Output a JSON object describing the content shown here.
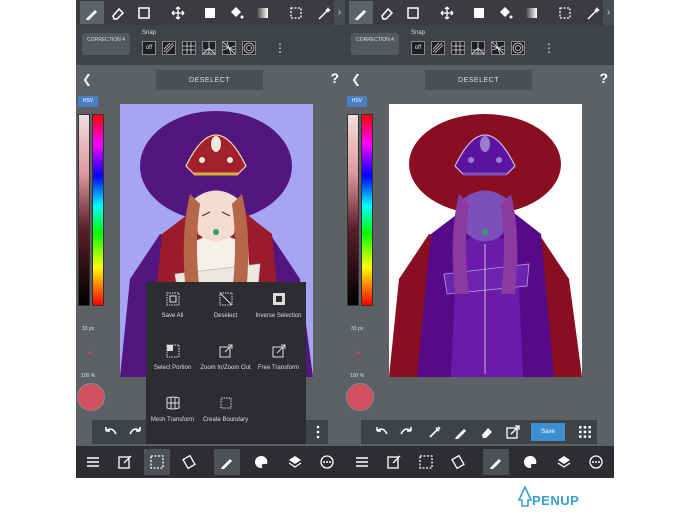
{
  "colors": {
    "phone_bg": "#5d6064",
    "toolbar": "#3a3c40",
    "accent": "#3d8fd0",
    "brand": "#3aa0d4"
  },
  "phones": [
    {
      "id": "left",
      "toolbar_icons": [
        "pen-icon",
        "eraser-icon",
        "rectangle-icon",
        "move-icon",
        "fill-rect-icon",
        "bucket-icon",
        "gradient-icon",
        "select-rect-icon",
        "magic-wand-icon"
      ],
      "correction": "CORRECTION 4",
      "snap_label": "Snap",
      "snap_off": "off",
      "deselect": "DESELECT",
      "hsv": "HSV",
      "brush_size": "33 px",
      "opacity": "100 %",
      "save": ""
    },
    {
      "id": "right",
      "correction": "CORRECTION 4",
      "snap_label": "Snap",
      "snap_off": "off",
      "deselect": "DESELECT",
      "hsv": "HSV",
      "brush_size": "33 px",
      "opacity": "100 %",
      "save": "Save"
    }
  ],
  "popup_menu": [
    {
      "label": "Save All",
      "icon": "save-all-icon"
    },
    {
      "label": "Deselect",
      "icon": "deselect-icon"
    },
    {
      "label": "Inverse Selection",
      "icon": "inverse-selection-icon"
    },
    {
      "label": "Select Portion",
      "icon": "select-portion-icon"
    },
    {
      "label": "Zoom In/Zoom Out",
      "icon": "zoom-icon"
    },
    {
      "label": "Free Transform",
      "icon": "free-transform-icon"
    },
    {
      "label": "Mesh Transform",
      "icon": "mesh-transform-icon"
    },
    {
      "label": "Create Boundary",
      "icon": "create-boundary-icon"
    }
  ],
  "logo": {
    "text": "PENUP"
  }
}
